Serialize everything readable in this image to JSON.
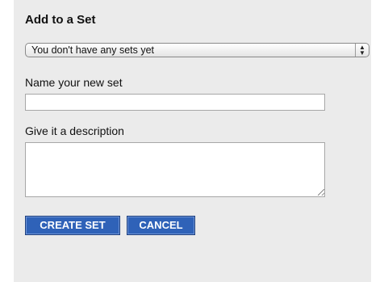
{
  "dialog": {
    "title": "Add to a Set",
    "set_select": {
      "value": "You don't have any sets yet",
      "arrow_up": "▲",
      "arrow_down": "▼"
    },
    "name_field": {
      "label": "Name your new set",
      "value": "",
      "placeholder": ""
    },
    "description_field": {
      "label": "Give it a description",
      "value": "",
      "placeholder": ""
    },
    "buttons": {
      "create_label": "CREATE SET",
      "cancel_label": "CANCEL"
    },
    "colors": {
      "panel_background": "#ebebeb",
      "button_background": "#2f62b8",
      "button_text": "#ffffff"
    }
  }
}
